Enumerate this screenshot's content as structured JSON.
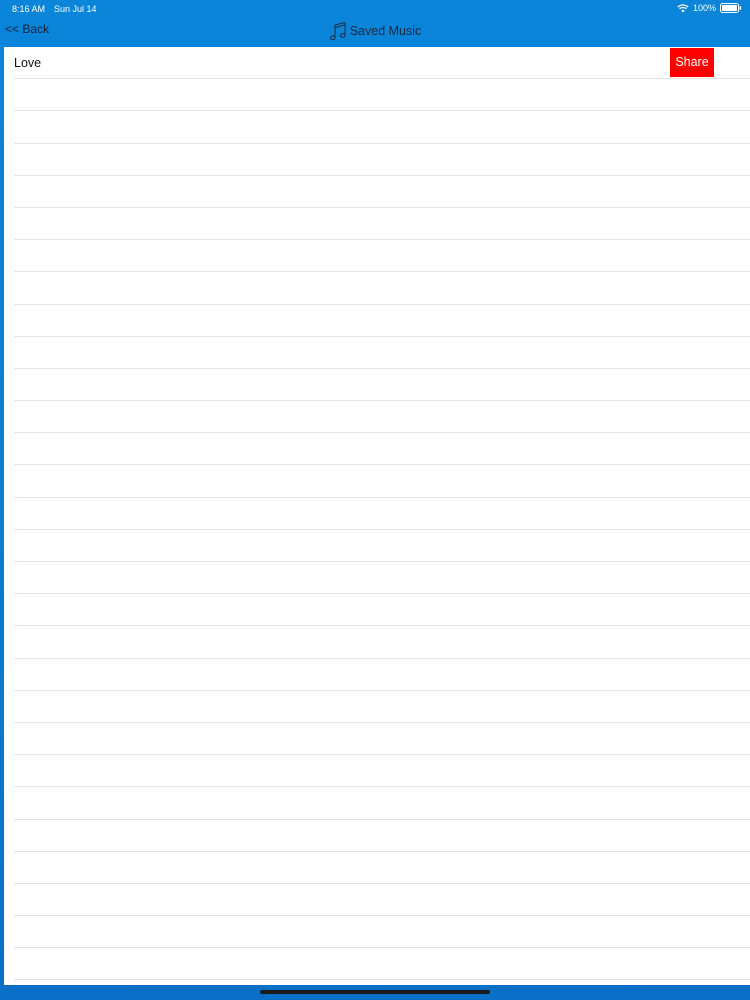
{
  "status_bar": {
    "time": "8:16 AM",
    "date": "Sun Jul 14",
    "battery_percent": "100%",
    "icons": [
      "wifi-icon",
      "battery-icon"
    ]
  },
  "nav": {
    "back_label": "<< Back",
    "title": "Saved Music",
    "title_icon": "music-note-icon"
  },
  "list": {
    "items": [
      {
        "label": "Love",
        "action_label": "Share"
      }
    ],
    "empty_row_count": 28
  },
  "colors": {
    "background_blue": "#0a7fd3",
    "share_button": "#ff0000",
    "row_divider": "#e6e6e6"
  }
}
